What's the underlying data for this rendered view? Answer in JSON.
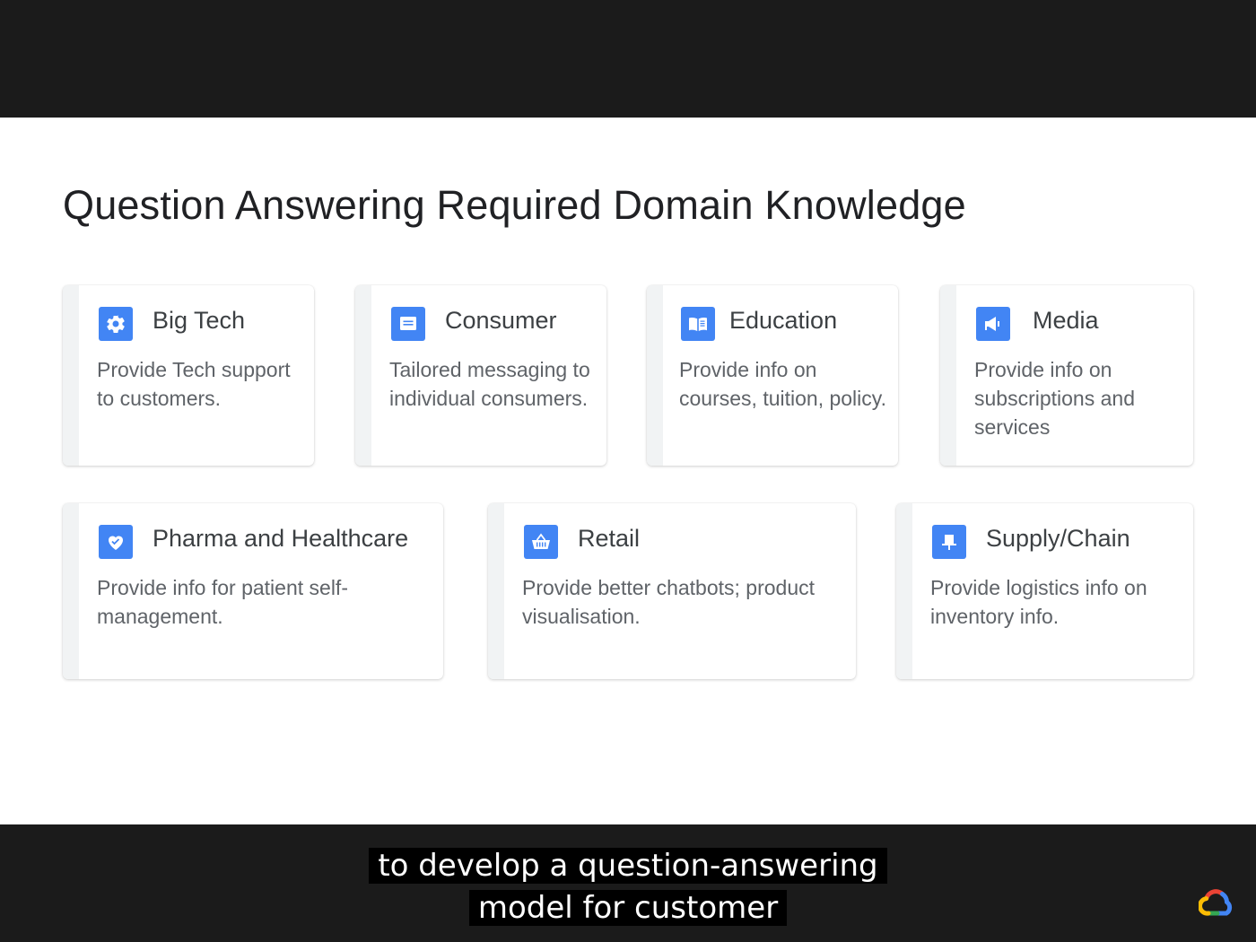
{
  "slide": {
    "title": "Question Answering Required Domain Knowledge",
    "cards": [
      {
        "title": "Big Tech",
        "description": "Provide Tech support to customers.",
        "icon": "gear-icon"
      },
      {
        "title": "Consumer",
        "description": "Tailored messaging to individual consumers.",
        "icon": "message-icon"
      },
      {
        "title": "Education",
        "description": "Provide info on courses, tuition, policy.",
        "icon": "book-icon"
      },
      {
        "title": "Media",
        "description": "Provide info on subscriptions and services",
        "icon": "megaphone-icon"
      },
      {
        "title": "Pharma and Healthcare",
        "description": "Provide info for patient self-management.",
        "icon": "heart-icon"
      },
      {
        "title": "Retail",
        "description": "Provide better chatbots; product visualisation.",
        "icon": "basket-icon"
      },
      {
        "title": "Supply/Chain",
        "description": "Provide logistics info on inventory info.",
        "icon": "warehouse-icon"
      }
    ]
  },
  "captions": {
    "line1": "to develop a question-answering",
    "line2": "model for customer"
  },
  "colors": {
    "accent": "#4285f4",
    "background_frame": "#1b1b1b",
    "slide_background": "#ffffff"
  },
  "logo": "google-cloud-logo"
}
